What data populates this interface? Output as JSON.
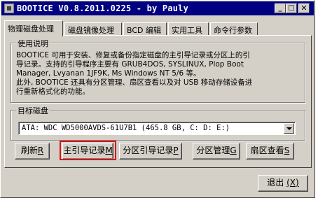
{
  "window": {
    "title": "BOOTICE V0.8.2011.0225 - by Pauly",
    "controls": {
      "minimize": "_",
      "maximize": "□",
      "close": "✕"
    }
  },
  "tabs": [
    {
      "label": "物理磁盘处理",
      "active": true
    },
    {
      "label": "磁盘镜像处理"
    },
    {
      "label": "BCD 编辑"
    },
    {
      "label": "实用工具"
    },
    {
      "label": "命令行参数"
    }
  ],
  "usage": {
    "legend": "使用说明",
    "text": "BOOTICE 可用于安装、修复或备份指定磁盘的主引导记录或分区上的引\n导记录。支持的引导程序主要有 GRUB4DOS, SYSLINUX, Plop Boot\nManager, Lvyanan 1JF9K, Ms Windows NT 5/6 等。\n此外, BOOTICE 还具有分区管理、扇区查看以及对 USB 移动存储设备进\n行重新格式化的功能。"
  },
  "target_disk": {
    "legend": "目标磁盘",
    "selected": "ATA: WDC WD5000AVDS-61U7B1 (465.8 GB, C: D: E:)"
  },
  "buttons": {
    "refresh": {
      "label": "刷新",
      "key": "R"
    },
    "mbr": {
      "label": "主引导记录",
      "key": "M"
    },
    "pbr": {
      "label": "分区引导记录",
      "key": "P"
    },
    "partition": {
      "label": "分区管理",
      "key": "G"
    },
    "sector": {
      "label": "扇区查看",
      "key": "S"
    }
  },
  "exit": {
    "label": "退出",
    "key": "(X)"
  },
  "colors": {
    "titlebar": "#000080",
    "highlight": "#e01010",
    "face": "#d4d0c8"
  }
}
